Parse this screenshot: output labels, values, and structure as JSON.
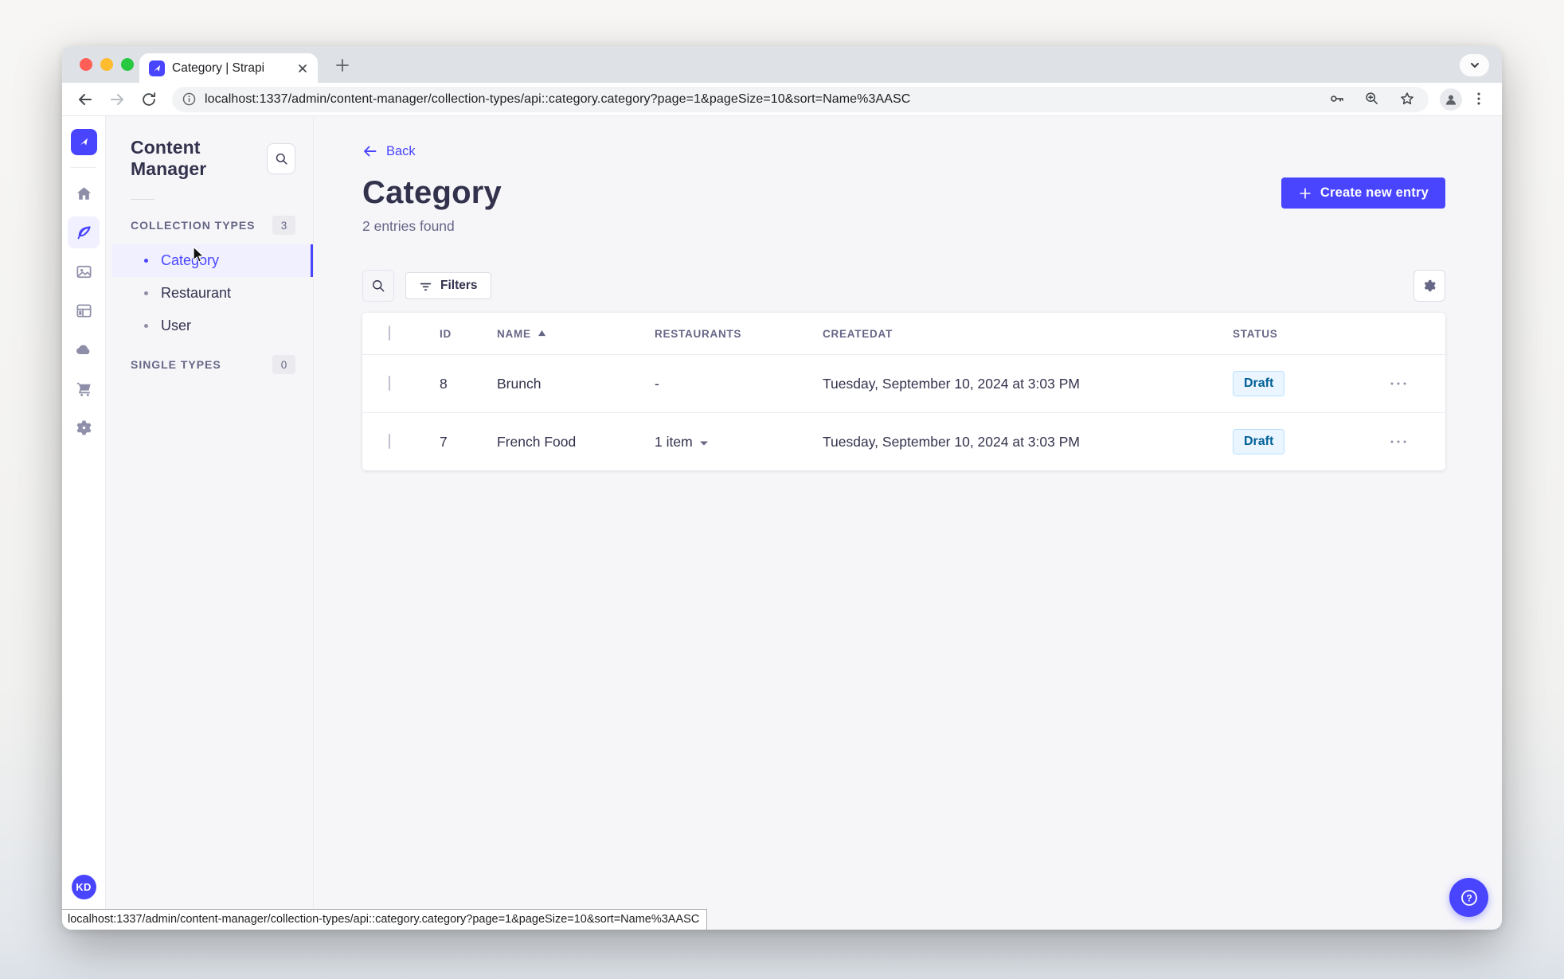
{
  "chrome": {
    "tab": {
      "title": "Category | Strapi"
    },
    "url": "localhost:1337/admin/content-manager/collection-types/api::category.category?page=1&pageSize=10&sort=Name%3AASC",
    "status_bar_url": "localhost:1337/admin/content-manager/collection-types/api::category.category?page=1&pageSize=10&sort=Name%3AASC"
  },
  "subnav": {
    "title": "Content Manager",
    "collection_types": {
      "label": "COLLECTION TYPES",
      "count": "3"
    },
    "items": [
      {
        "label": "Category"
      },
      {
        "label": "Restaurant"
      },
      {
        "label": "User"
      }
    ],
    "single_types": {
      "label": "SINGLE TYPES",
      "count": "0"
    }
  },
  "header": {
    "back": "Back",
    "title": "Category",
    "subtitle": "2 entries found",
    "create_button": "Create new entry"
  },
  "actions": {
    "filters": "Filters"
  },
  "table": {
    "headers": {
      "id": "ID",
      "name": "NAME",
      "restaurants": "RESTAURANTS",
      "createdat": "CREATEDAT",
      "status": "STATUS"
    },
    "rows": [
      {
        "id": "8",
        "name": "Brunch",
        "restaurants": "-",
        "createdat": "Tuesday, September 10, 2024 at 3:03 PM",
        "status": "Draft"
      },
      {
        "id": "7",
        "name": "French Food",
        "restaurants": "1 item",
        "createdat": "Tuesday, September 10, 2024 at 3:03 PM",
        "status": "Draft"
      }
    ]
  },
  "user": {
    "initials": "KD"
  },
  "colors": {
    "primary": "#4945FF",
    "active_item_bg": "#F0F0FF",
    "draft_bg": "#EAF5FF",
    "draft_border": "#B8E1FF",
    "draft_text": "#006096"
  }
}
